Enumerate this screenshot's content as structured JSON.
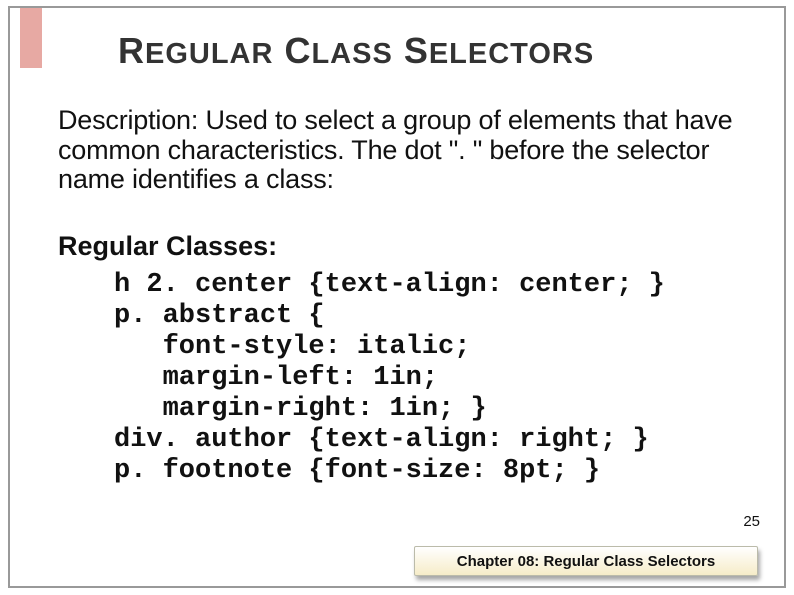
{
  "title": {
    "w1a": "R",
    "w1b": "EGULAR",
    "w2a": "C",
    "w2b": "LASS",
    "w3a": "S",
    "w3b": "ELECTORS"
  },
  "description": "Description: Used to select a group of elements that have common characteristics. The dot \". \" before the selector name identifies a class:",
  "subheading": "Regular Classes:",
  "code": "h 2. center {text-align: center; }\np. abstract {\n   font-style: italic;\n   margin-left: 1in;\n   margin-right: 1in; }\ndiv. author {text-align: right; }\np. footnote {font-size: 8pt; }",
  "page_number": "25",
  "footer": "Chapter  08: Regular Class Selectors"
}
